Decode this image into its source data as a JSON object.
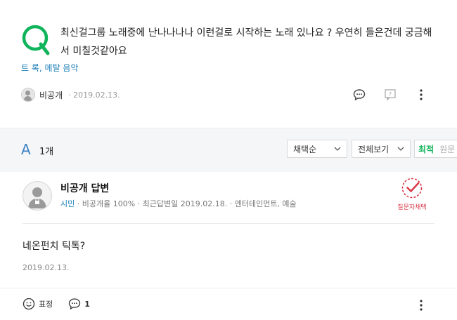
{
  "question": {
    "mark": "Q",
    "text": "최신걸그룹 노래중에 난나나나나 이런걸로 시작하는 노래 있나요 ? 우연히 들은건데 궁금해서 미칠것같아요",
    "tags": "트 록, 메탈 음악",
    "author": "비공개",
    "date": "· 2019.02.13.",
    "icons": [
      "comment-icon",
      "report-icon",
      "more-icon"
    ]
  },
  "answers": {
    "letter": "A",
    "count": "1개",
    "sort_value": "채택순",
    "view_value": "전체보기",
    "seg_active": "최적",
    "seg_inactive": "원문"
  },
  "answer": {
    "title": "비공개 답변",
    "rank": "시민",
    "meta": " · 비공개율 100% · 최근답변일 2019.02.18. · 엔터테인먼트, 예술",
    "chosen_label": "질문자채택",
    "body": "네온펀치 틱톡?",
    "date": "2019.02.13.",
    "reaction_label": "표정",
    "comment_count": "1"
  },
  "colors": {
    "q_green": "#10b45a",
    "accent_blue": "#3b82c4",
    "chosen_red": "#d93a4a"
  }
}
